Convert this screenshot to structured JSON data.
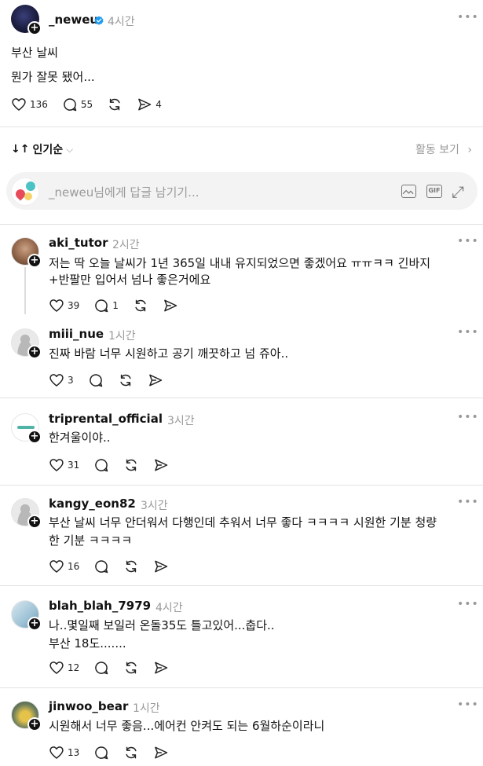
{
  "post": {
    "username": "_neweu",
    "time": "4시간",
    "lines": [
      "부산 날씨",
      "뭔가 잘못 됐어..."
    ],
    "likes": "136",
    "comments": "55",
    "shares": "4"
  },
  "sort": {
    "label": "인기순",
    "activity_label": "활동 보기"
  },
  "reply": {
    "placeholder": "_neweu님에게 답글 남기기..."
  },
  "comments": [
    {
      "username": "aki_tutor",
      "time": "2시간",
      "lines": [
        "저는 딱 오늘 날씨가 1년 365일 내내 유지되었으면 좋겠어요 ㅠㅠㅋㅋ 긴바지",
        "+반팔만 입어서 넘나 좋은거에요"
      ],
      "likes": "39",
      "comments": "1"
    },
    {
      "username": "miii_nue",
      "time": "1시간",
      "lines": [
        "진짜 바람 너무 시원하고 공기 깨끗하고 넘 쥬아.."
      ],
      "likes": "3",
      "comments": ""
    },
    {
      "username": "triprental_official",
      "time": "3시간",
      "lines": [
        "한겨울이야.."
      ],
      "likes": "31",
      "comments": ""
    },
    {
      "username": "kangy_eon82",
      "time": "3시간",
      "lines": [
        "부산 날씨 너무 안더워서 다행인데 추워서 너무 좋다 ㅋㅋㅋㅋ 시원한 기분 청량",
        "한 기분 ㅋㅋㅋㅋ"
      ],
      "likes": "16",
      "comments": ""
    },
    {
      "username": "blah_blah_7979",
      "time": "4시간",
      "lines": [
        "나..몇일째 보일러 온돌35도 틀고있어...춥다..",
        "부산 18도......."
      ],
      "likes": "12",
      "comments": ""
    },
    {
      "username": "jinwoo_bear",
      "time": "1시간",
      "lines": [
        "시원해서 너무 좋음...에어컨 안켜도 되는 6월하순이라니"
      ],
      "likes": "13",
      "comments": ""
    }
  ],
  "icons": {
    "like": "heart-icon",
    "comment": "comment-bubble-icon",
    "repost": "repost-icon",
    "share": "send-icon",
    "verified": "verified-badge-icon",
    "image": "image-icon",
    "gif": "gif-icon",
    "expand": "expand-icon"
  },
  "colors": {
    "verified": "#1d9bf0",
    "muted": "#999999",
    "divider": "#e2e2e2"
  }
}
